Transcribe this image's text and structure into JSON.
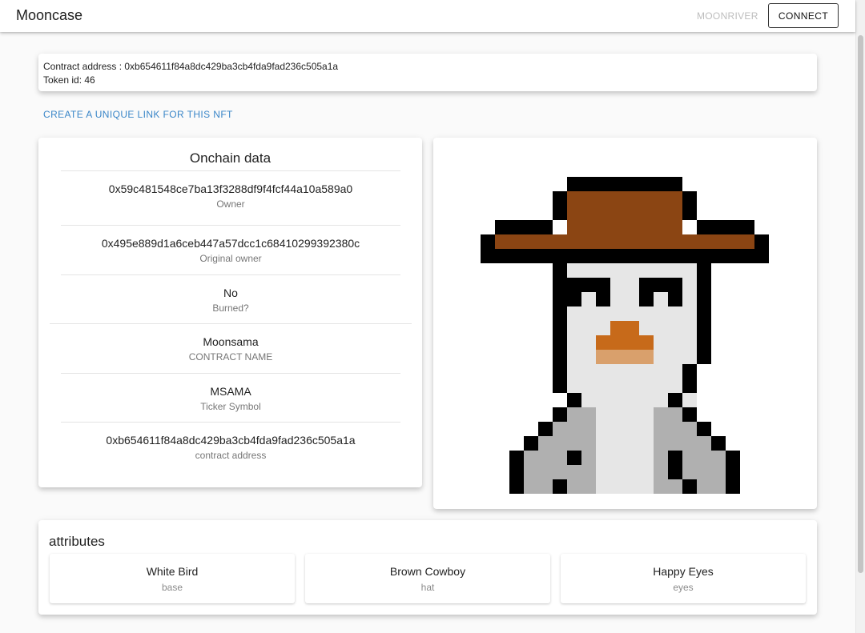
{
  "appbar": {
    "brand": "Mooncase",
    "network": "MOONRIVER",
    "connect_label": "CONNECT"
  },
  "contract_info": {
    "address_line": "Contract address : 0xb654611f84a8dc429ba3cb4fda9fad236c505a1a",
    "token_line": "Token id: 46"
  },
  "unique_link_label": "CREATE A UNIQUE LINK FOR THIS NFT",
  "onchain": {
    "title": "Onchain data",
    "rows": [
      {
        "value": "0x59c481548ce7ba13f3288df9f4fcf44a10a589a0",
        "label": "Owner"
      },
      {
        "value": "0x495e889d1a6ceb447a57dcc1c68410299392380c",
        "label": "Original owner"
      },
      {
        "value": "No",
        "label": "Burned?"
      },
      {
        "value": "Moonsama",
        "label": "CONTRACT NAME"
      },
      {
        "value": "MSAMA",
        "label": "Ticker Symbol"
      },
      {
        "value": "0xb654611f84a8dc429ba3cb4fda9fad236c505a1a",
        "label": "contract address"
      }
    ]
  },
  "nft_image": {
    "subject": "pixel-art white bird wearing brown cowboy hat",
    "colors": {
      "outline": "#000000",
      "hat": "#8b4513",
      "body": "#e6e6e6",
      "shade": "#b0b0b0",
      "beak_top": "#c76a1a",
      "beak_bottom": "#d9a06c"
    }
  },
  "attributes": {
    "title": "attributes",
    "items": [
      {
        "value": "White Bird",
        "label": "base"
      },
      {
        "value": "Brown Cowboy",
        "label": "hat"
      },
      {
        "value": "Happy Eyes",
        "label": "eyes"
      }
    ]
  }
}
